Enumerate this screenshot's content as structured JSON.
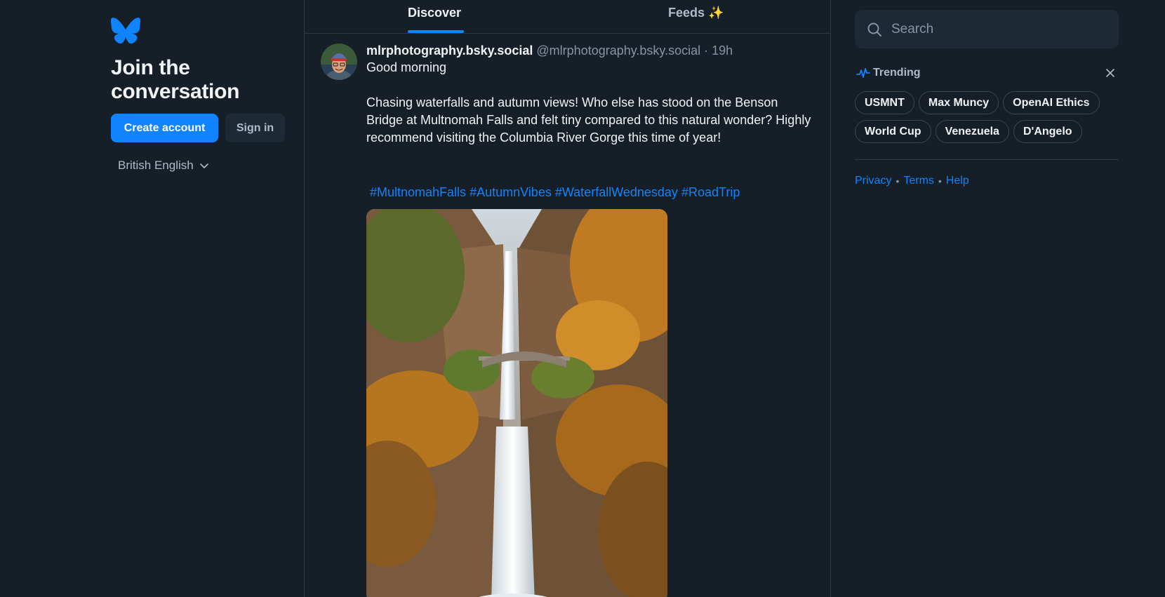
{
  "sidebar": {
    "title": "Join the conversation",
    "create_account": "Create account",
    "sign_in": "Sign in",
    "language": "British English"
  },
  "tabs": [
    {
      "label": "Discover",
      "active": true
    },
    {
      "label": "Feeds ✨",
      "active": false
    }
  ],
  "post": {
    "author": "mlrphotography.bsky.social",
    "handle": "@mlrphotography.bsky.social",
    "separator": "·",
    "time": "19h",
    "greeting": "Good morning",
    "body": "Chasing waterfalls and autumn views! Who else has stood on the Benson Bridge at Multnomah Falls and felt tiny compared to this natural wonder? Highly recommend visiting the Columbia River Gorge this time of year!",
    "hashtags": [
      "#MultnomahFalls",
      "#AutumnVibes",
      "#WaterfallWednesday",
      "#RoadTrip"
    ]
  },
  "search": {
    "placeholder": "Search"
  },
  "trending": {
    "label": "Trending",
    "topics": [
      "USMNT",
      "Max Muncy",
      "OpenAI Ethics",
      "World Cup",
      "Venezuela",
      "D'Angelo"
    ]
  },
  "footer": {
    "links": [
      "Privacy",
      "Terms",
      "Help"
    ],
    "separator": "•"
  },
  "colors": {
    "background": "#161e27",
    "accent": "#1083fe",
    "border": "#2e3a47",
    "muted_text": "#8594a5"
  }
}
